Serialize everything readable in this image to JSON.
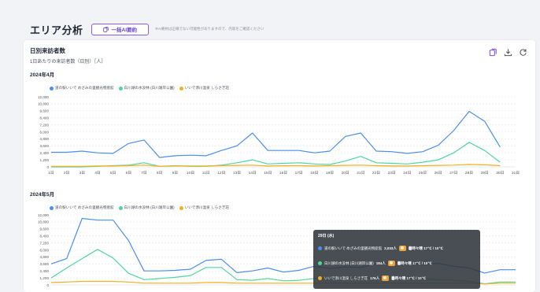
{
  "header": {
    "title": "エリア分析",
    "ai_button_label": "一括AI要約",
    "note": "※AI要約は正確でない可能性がありますので、内容をご確認ください"
  },
  "card": {
    "title": "日別来訪者数",
    "subtitle": "1日あたりの来訪者数（日別）［人］",
    "icons": [
      "ai-summary-icon",
      "download-icon",
      "refresh-icon"
    ]
  },
  "colors": {
    "blue": "#4a8ef0",
    "green": "#4fd69a",
    "orange": "#f2b01e",
    "accent": "#7b4be0"
  },
  "chart_data": [
    {
      "type": "line",
      "title": "2024年4月",
      "categories": [
        "1日",
        "2日",
        "3日",
        "4日",
        "5日",
        "6日",
        "7日",
        "8日",
        "9日",
        "10日",
        "11日",
        "12日",
        "13日",
        "14日",
        "15日",
        "16日",
        "17日",
        "18日",
        "19日",
        "20日",
        "21日",
        "22日",
        "23日",
        "24日",
        "25日",
        "26日",
        "27日",
        "28日",
        "29日",
        "30日",
        "31日"
      ],
      "yticks": [
        "12,000",
        "10,800",
        "9,600",
        "8,400",
        "7,200",
        "6,000",
        "4,800",
        "3,600",
        "2,400",
        "1,200",
        "0"
      ],
      "ylim": [
        0,
        12000
      ],
      "series": [
        {
          "name": "道の駅いいで めざみの里観光物産館",
          "color": "#4a8ef0",
          "values": [
            2500,
            2500,
            2700,
            2400,
            2300,
            4000,
            4600,
            1600,
            1900,
            2000,
            1900,
            2800,
            3600,
            5800,
            2800,
            2800,
            2800,
            2400,
            2700,
            5200,
            5800,
            2700,
            2600,
            2300,
            2600,
            3700,
            6200,
            9500,
            7800,
            3400,
            null
          ]
        },
        {
          "name": "白川湖の水没林 (白川湖岸公園)",
          "color": "#4fd69a",
          "values": [
            0,
            0,
            0,
            100,
            200,
            300,
            700,
            100,
            200,
            100,
            100,
            300,
            700,
            1200,
            500,
            600,
            700,
            500,
            400,
            1000,
            1800,
            700,
            600,
            500,
            800,
            1200,
            2400,
            4200,
            2800,
            800,
            null
          ]
        },
        {
          "name": "いいで添川温泉 しらさぎ荘",
          "color": "#f2b01e",
          "values": [
            100,
            100,
            100,
            150,
            150,
            200,
            300,
            100,
            150,
            150,
            150,
            200,
            250,
            300,
            150,
            200,
            200,
            150,
            200,
            250,
            300,
            200,
            150,
            150,
            200,
            250,
            300,
            400,
            350,
            200,
            null
          ]
        }
      ],
      "grid": true,
      "legend": "top-left"
    },
    {
      "type": "line",
      "title": "2024年5月",
      "yticks": [
        "12,000",
        "10,800",
        "9,600",
        "8,400",
        "7,200",
        "6,000",
        "4,800",
        "3,600",
        "2,400",
        "1,200",
        "0"
      ],
      "ylim": [
        0,
        12000
      ],
      "series": [
        {
          "name": "道の駅いいで めざみの里観光物産館",
          "color": "#4a8ef0",
          "values": [
            3600,
            4500,
            11400,
            11100,
            11100,
            7600,
            2400,
            2400,
            2500,
            2700,
            4200,
            4400,
            2100,
            2400,
            2900,
            2200,
            2500,
            3200,
            2800,
            3100,
            3000,
            3600,
            3800,
            4000,
            3500,
            3700,
            3200,
            2900,
            2033,
            2600,
            2600
          ]
        },
        {
          "name": "白川湖の水没林 (白川湖岸公園)",
          "color": "#4fd69a",
          "values": [
            1200,
            2900,
            4500,
            6100,
            4600,
            2000,
            900,
            1100,
            1300,
            1600,
            3000,
            3000,
            900,
            800,
            1100,
            700,
            800,
            1100,
            1000,
            1200,
            1100,
            1300,
            1200,
            1100,
            1000,
            900,
            800,
            600,
            184,
            500,
            500
          ]
        },
        {
          "name": "いいで添川温泉 しらさぎ荘",
          "color": "#f2b01e",
          "values": [
            400,
            500,
            600,
            600,
            600,
            500,
            300,
            300,
            300,
            300,
            400,
            400,
            300,
            300,
            300,
            300,
            300,
            300,
            300,
            300,
            300,
            300,
            300,
            300,
            300,
            300,
            300,
            300,
            176,
            300,
            300
          ]
        }
      ],
      "grid": true,
      "legend": "top-left"
    }
  ],
  "tooltip": {
    "date": "29日 (水)",
    "rows": [
      {
        "label": "道の駅いいで めざみの里観光物産館",
        "value": "2,033人",
        "weather": "曇時々晴 17℃ / 10℃",
        "color": "#4a8ef0"
      },
      {
        "label": "白川湖の水没林 (白川湖岸公園)",
        "value": "184人",
        "weather": "曇時々晴 17℃ / 10℃",
        "color": "#4fd69a"
      },
      {
        "label": "いいで添川温泉 しらさぎ荘",
        "value": "176人",
        "weather": "曇時々晴 17℃ / 10℃",
        "color": "#f2b01e"
      }
    ]
  }
}
